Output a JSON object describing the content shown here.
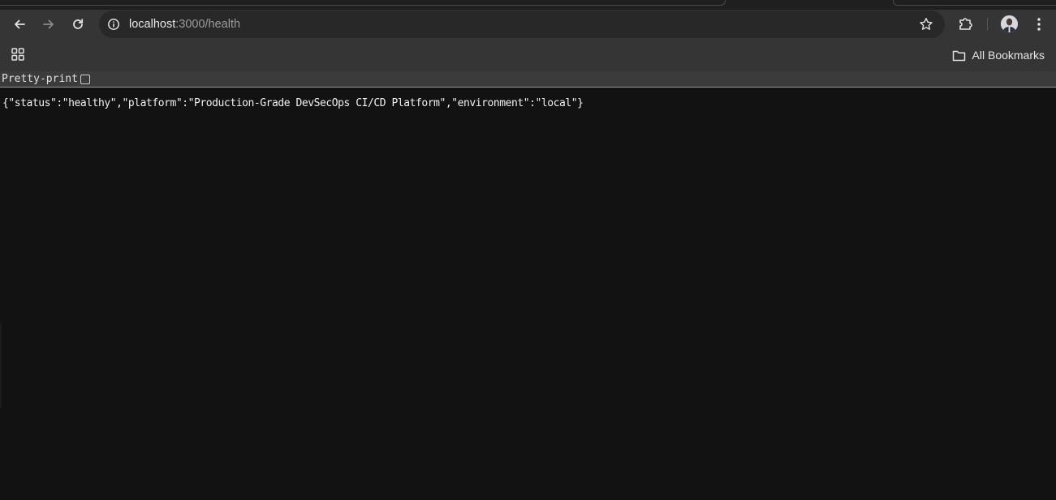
{
  "browser": {
    "url_host": "localhost",
    "url_rest": ":3000/health",
    "icons": {
      "back": "back-arrow-icon",
      "forward": "forward-arrow-icon",
      "reload": "reload-icon",
      "site_info": "info-icon",
      "bookmark": "star-icon",
      "extensions": "puzzle-icon",
      "menu": "kebab-menu-icon",
      "apps": "apps-grid-icon",
      "folder": "folder-icon"
    },
    "bookmarks_label": "All Bookmarks"
  },
  "viewer": {
    "pretty_print_label": "Pretty-print",
    "pretty_print_checked": false,
    "json_text": "{\"status\":\"healthy\",\"platform\":\"Production-Grade DevSecOps CI/CD Platform\",\"environment\":\"local\"}"
  },
  "colors": {
    "page_bg": "#121212",
    "chrome_bg": "#353535",
    "omnibox_bg": "#282828"
  }
}
